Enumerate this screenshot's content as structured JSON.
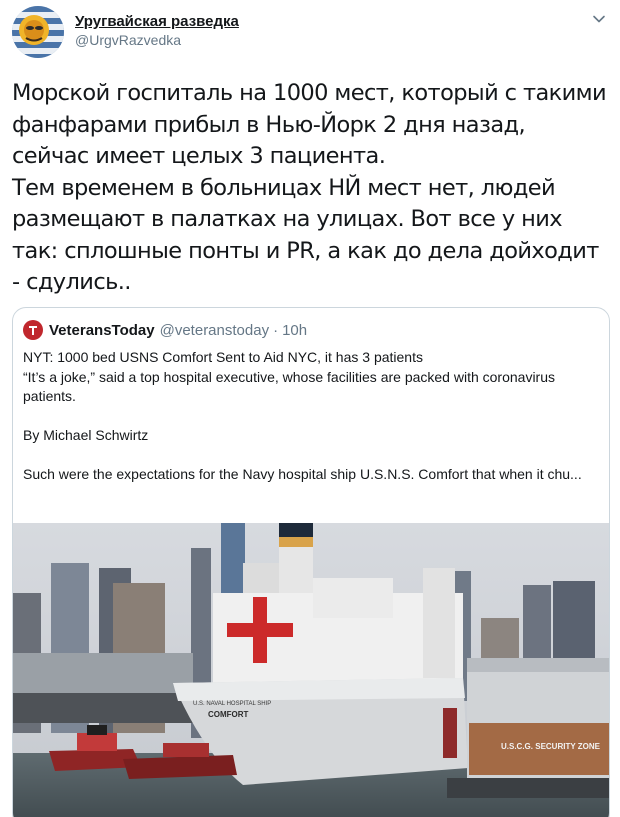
{
  "author": {
    "display_name": "Уругвайская разведка",
    "handle": "@UrgvRazvedka"
  },
  "tweet": {
    "text": "Морской госпиталь на 1000 мест, который с такими фанфарами прибыл в Нью-Йорк 2 дня назад, сейчас имеет целых 3 пациента.\nТем временем в больницах НЙ мест нет, людей размещают в палатках на улицах. Вот все у них так: сплошные понты и PR, а как до дела дойходит - сдулись.."
  },
  "quote": {
    "display_name": "VeteransToday",
    "handle": "@veteranstoday",
    "separator": "·",
    "time": "10h",
    "headline": "NYT: 1000 bed USNS Comfort Sent to Aid NYC, it has 3 patients",
    "lead": "“It’s a joke,” said a top hospital executive, whose facilities are packed with coronavirus patients.",
    "byline": "By Michael Schwirtz",
    "excerpt": "Such were the expectations for the Navy hospital ship U.S.N.S. Comfort that when it chu...",
    "image": {
      "hull_text_1": "U.S. NAVAL HOSPITAL SHIP",
      "hull_text_2": "COMFORT",
      "zone_sign": "U.S.C.G. SECURITY ZONE"
    }
  },
  "colors": {
    "text": "#14171a",
    "secondary": "#657786",
    "border": "#ccd6dd",
    "brand_red": "#c0272d"
  },
  "icons": [
    "avatar-flag-icon",
    "chevron-down-icon",
    "veterans-today-logo-icon"
  ]
}
